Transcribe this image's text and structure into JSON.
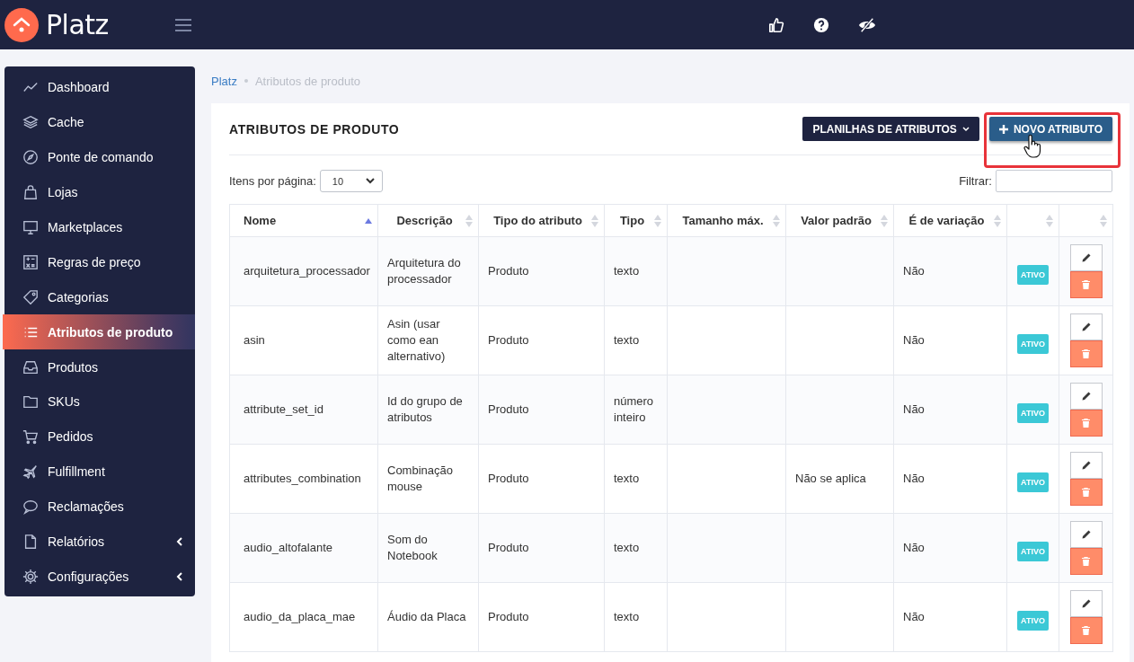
{
  "brand": {
    "name": "Platz"
  },
  "sidebar": {
    "items": [
      {
        "label": "Dashboard",
        "selected": false,
        "has_submenu": false
      },
      {
        "label": "Cache",
        "selected": false,
        "has_submenu": false
      },
      {
        "label": "Ponte de comando",
        "selected": false,
        "has_submenu": false
      },
      {
        "label": "Lojas",
        "selected": false,
        "has_submenu": false
      },
      {
        "label": "Marketplaces",
        "selected": false,
        "has_submenu": false
      },
      {
        "label": "Regras de preço",
        "selected": false,
        "has_submenu": false
      },
      {
        "label": "Categorias",
        "selected": false,
        "has_submenu": false
      },
      {
        "label": "Atributos de produto",
        "selected": true,
        "has_submenu": false
      },
      {
        "label": "Produtos",
        "selected": false,
        "has_submenu": false
      },
      {
        "label": "SKUs",
        "selected": false,
        "has_submenu": false
      },
      {
        "label": "Pedidos",
        "selected": false,
        "has_submenu": false
      },
      {
        "label": "Fulfillment",
        "selected": false,
        "has_submenu": false
      },
      {
        "label": "Reclamações",
        "selected": false,
        "has_submenu": false
      },
      {
        "label": "Relatórios",
        "selected": false,
        "has_submenu": true
      },
      {
        "label": "Configurações",
        "selected": false,
        "has_submenu": true
      }
    ]
  },
  "breadcrumb": [
    "Platz",
    "Atributos de produto"
  ],
  "card": {
    "title": "ATRIBUTOS DE PRODUTO",
    "buttons": [
      {
        "label": "PLANILHAS DE ATRIBUTOS",
        "kind": "dropdown",
        "highlighted": false
      },
      {
        "label": "NOVO ATRIBUTO",
        "kind": "add",
        "highlighted": true
      }
    ],
    "per_page": {
      "label": "Itens por página:",
      "value": "10"
    },
    "filter": {
      "label": "Filtrar:"
    }
  },
  "table": {
    "columns": [
      {
        "label": "Nome",
        "sorted": true
      },
      {
        "label": "Descrição",
        "sorted": false
      },
      {
        "label": "Tipo do atributo",
        "sorted": false
      },
      {
        "label": "Tipo",
        "sorted": false
      },
      {
        "label": "Tamanho máx.",
        "sorted": false
      },
      {
        "label": "Valor padrão",
        "sorted": false
      },
      {
        "label": "É de variação",
        "sorted": false
      },
      {
        "sorted": false
      },
      {
        "sorted": false
      }
    ],
    "rows": [
      {
        "name": "arquitetura_processador",
        "description": "Arquitetura do processador",
        "attribute_type": "Produto",
        "type": "texto",
        "is_variation": "Não",
        "status": "ATIVO"
      },
      {
        "name": "asin",
        "description": "Asin (usar como ean alternativo)",
        "attribute_type": "Produto",
        "type": "texto",
        "is_variation": "Não",
        "status": "ATIVO"
      },
      {
        "name": "attribute_set_id",
        "description": "Id do grupo de atributos",
        "attribute_type": "Produto",
        "type": "número inteiro",
        "is_variation": "Não",
        "status": "ATIVO"
      },
      {
        "name": "attributes_combination",
        "description": "Combinação mouse",
        "attribute_type": "Produto",
        "type": "texto",
        "default_value": "Não se aplica",
        "is_variation": "Não",
        "status": "ATIVO"
      },
      {
        "name": "audio_altofalante",
        "description": "Som do Notebook",
        "attribute_type": "Produto",
        "type": "texto",
        "is_variation": "Não",
        "status": "ATIVO"
      },
      {
        "name": "audio_da_placa_mae",
        "description": "Áudio da Placa",
        "attribute_type": "Produto",
        "type": "texto",
        "is_variation": "Não",
        "status": "ATIVO"
      }
    ]
  }
}
